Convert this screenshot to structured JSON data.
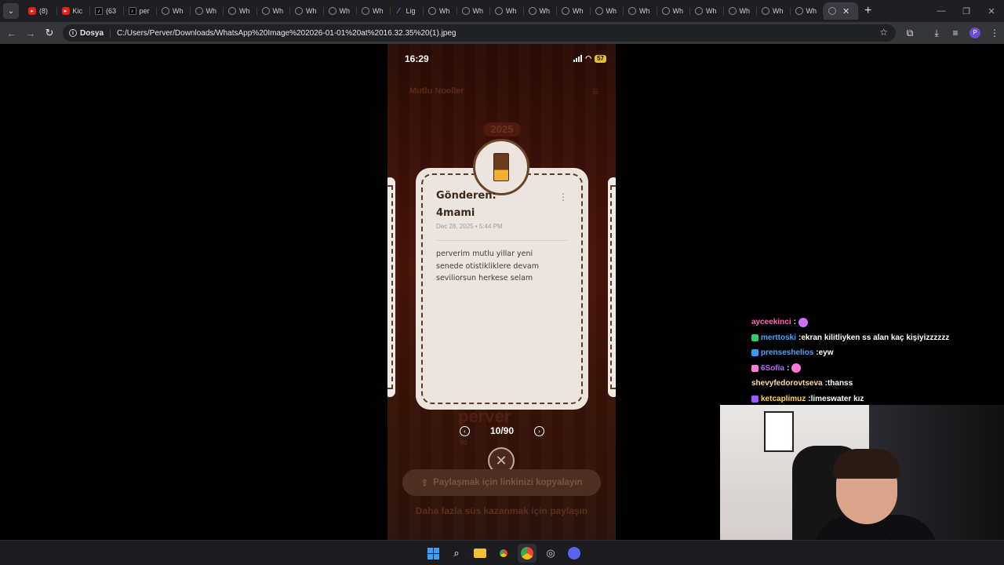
{
  "browser": {
    "tabs": [
      {
        "label": "(8)",
        "favicon": "youtube-icon"
      },
      {
        "label": "Kic",
        "favicon": "youtube-icon"
      },
      {
        "label": "(63",
        "favicon": "tiktok-icon"
      },
      {
        "label": "per",
        "favicon": "tiktok-icon"
      },
      {
        "label": "Wh",
        "favicon": "whatsapp-icon"
      },
      {
        "label": "Wh",
        "favicon": "whatsapp-icon"
      },
      {
        "label": "Wh",
        "favicon": "whatsapp-icon"
      },
      {
        "label": "Wh",
        "favicon": "whatsapp-icon"
      },
      {
        "label": "Wh",
        "favicon": "whatsapp-icon"
      },
      {
        "label": "Wh",
        "favicon": "whatsapp-icon"
      },
      {
        "label": "Wh",
        "favicon": "whatsapp-icon"
      },
      {
        "label": "Lig",
        "favicon": "feather-icon"
      },
      {
        "label": "Wh",
        "favicon": "whatsapp-icon"
      },
      {
        "label": "Wh",
        "favicon": "whatsapp-icon"
      },
      {
        "label": "Wh",
        "favicon": "whatsapp-icon"
      },
      {
        "label": "Wh",
        "favicon": "whatsapp-icon"
      },
      {
        "label": "Wh",
        "favicon": "whatsapp-icon"
      },
      {
        "label": "Wh",
        "favicon": "whatsapp-icon"
      },
      {
        "label": "Wh",
        "favicon": "whatsapp-icon"
      },
      {
        "label": "Wh",
        "favicon": "whatsapp-icon"
      },
      {
        "label": "Wh",
        "favicon": "whatsapp-icon"
      },
      {
        "label": "Wh",
        "favicon": "whatsapp-icon"
      },
      {
        "label": "Wh",
        "favicon": "whatsapp-icon"
      },
      {
        "label": "Wh",
        "favicon": "whatsapp-icon"
      }
    ],
    "site_chip": "Dosya",
    "url": "C:/Users/Perver/Downloads/WhatsApp%20Image%202026-01-01%20at%2016.32.35%20(1).jpeg",
    "profile_initial": "P"
  },
  "phone": {
    "time": "16:29",
    "battery": "57",
    "header_title": "Mutlu Noeller",
    "year_badge": "2025",
    "card": {
      "sender_label": "Gönderen:",
      "sender_name": "4mami",
      "date": "Dec 28, 2025 • 5:44 PM",
      "message": "perverim mutlu yillar yeni senede otistikliklere devam seviliorsun herkese selam"
    },
    "pager": {
      "count": "10/90"
    },
    "dim_name": "perver",
    "dim_stats": "90",
    "share_button": "Paylaşmak için linkinizi kopyalayın",
    "footer_text": "Daha fazla süs kazanmak için paylaşın"
  },
  "chat": [
    {
      "user": "ayceekinci",
      "text": "",
      "user_color": "#ff69b4",
      "badge_color": "",
      "emote": "#d070ff"
    },
    {
      "user": "merttoski",
      "text": "ekran kilitliyken ss alan kaç kişiyizzzzzz",
      "user_color": "#4aa3ff",
      "badge_color": "#2ecc71",
      "emote": ""
    },
    {
      "user": "prenseshelios",
      "text": "eyw",
      "user_color": "#4aa3ff",
      "badge_color": "#2e9bff",
      "emote": ""
    },
    {
      "user": "6Sofia",
      "text": "",
      "user_color": "#b36bff",
      "badge_color": "#ff7ad6",
      "emote": "#ff7ad6"
    },
    {
      "user": "shevyfedorovtseva",
      "text": "thanss",
      "user_color": "#ffd9a0",
      "badge_color": "",
      "emote": ""
    },
    {
      "user": "ketcaplimuz",
      "text": "limeswater kız",
      "user_color": "#ffd54a",
      "badge_color": "#9b59ff",
      "emote": ""
    }
  ],
  "colors": {
    "accent_blue": "#3aa0ff",
    "card_bg": "#ece4de",
    "card_border": "#5a3b25"
  }
}
